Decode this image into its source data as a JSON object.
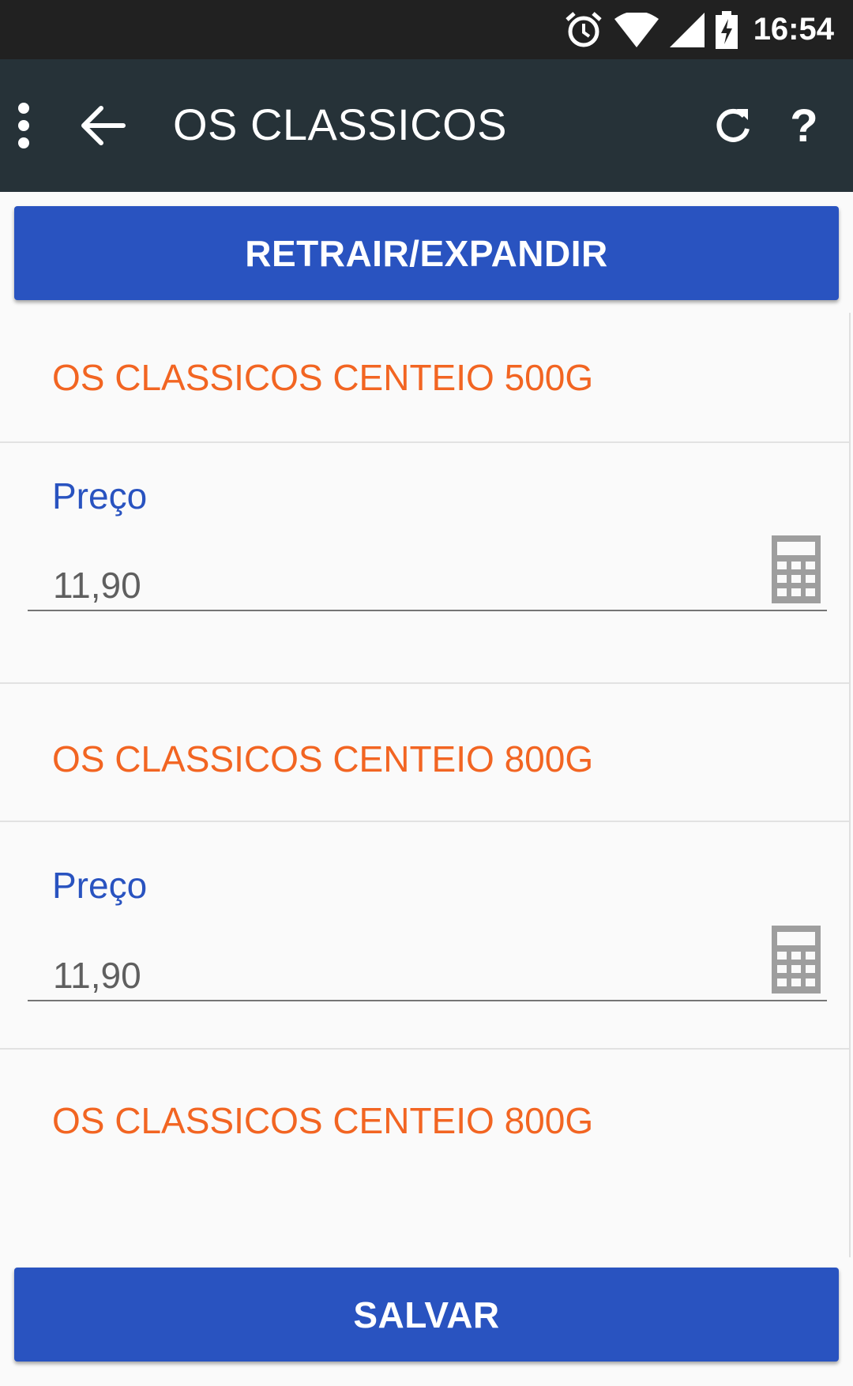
{
  "status_bar": {
    "time": "16:54",
    "icons": [
      "alarm-icon",
      "wifi-icon",
      "signal-icon",
      "battery-charging-icon"
    ]
  },
  "app_bar": {
    "title": "OS CLASSICOS",
    "menu_icon": "more-vert-icon",
    "back_icon": "arrow-back-icon",
    "refresh_icon": "refresh-icon",
    "help_label": "?"
  },
  "expand_button": {
    "label": "RETRAIR/EXPANDIR"
  },
  "products": [
    {
      "name": "OS CLASSICOS CENTEIO 500G",
      "price_label": "Preço",
      "price_value": "11,90"
    },
    {
      "name": "OS CLASSICOS CENTEIO 800G",
      "price_label": "Preço",
      "price_value": "11,90"
    },
    {
      "name": "OS CLASSICOS CENTEIO 800G"
    }
  ],
  "save_button": {
    "label": "SALVAR"
  },
  "colors": {
    "status_bar": "#212121",
    "app_bar": "#263238",
    "primary_button": "#2953c0",
    "product_title": "#f26522",
    "field_label": "#2953c0",
    "field_value": "#5f5f5f",
    "background": "#fafafa"
  }
}
